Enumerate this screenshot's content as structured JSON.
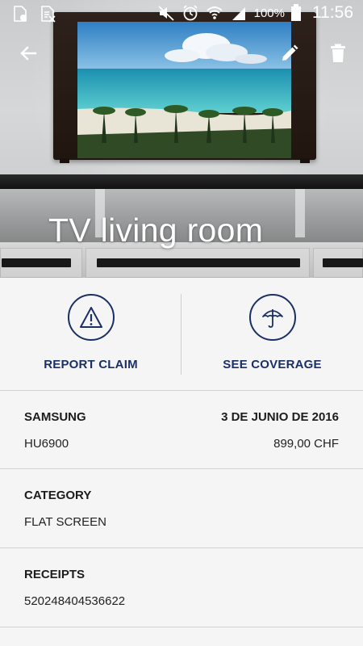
{
  "status_bar": {
    "battery_percent": "100%",
    "time": "11:56",
    "left_icons": [
      "sim-card-icon",
      "sim-blocked-icon"
    ],
    "right_icons": [
      "mute-icon",
      "alarm-icon",
      "wifi-icon",
      "signal-icon",
      "battery-icon"
    ]
  },
  "header": {
    "title": "TV living room",
    "back_icon": "arrow-back-icon",
    "edit_icon": "pencil-icon",
    "delete_icon": "trash-icon"
  },
  "actions": [
    {
      "label": "REPORT CLAIM",
      "icon": "warning-triangle-icon"
    },
    {
      "label": "SEE COVERAGE",
      "icon": "umbrella-icon"
    }
  ],
  "details": {
    "brand": {
      "label": "SAMSUNG",
      "value": "HU6900"
    },
    "purchase": {
      "date": "3 DE JUNIO DE 2016",
      "price": "899,00 CHF"
    },
    "category": {
      "label": "CATEGORY",
      "value": "FLAT SCREEN"
    },
    "receipts": {
      "label": "RECEIPTS",
      "value": "520248404536622"
    }
  },
  "colors": {
    "accent": "#1a2f64",
    "background": "#f5f5f5",
    "divider": "#d3d3d3",
    "text": "#1c1c1c"
  }
}
